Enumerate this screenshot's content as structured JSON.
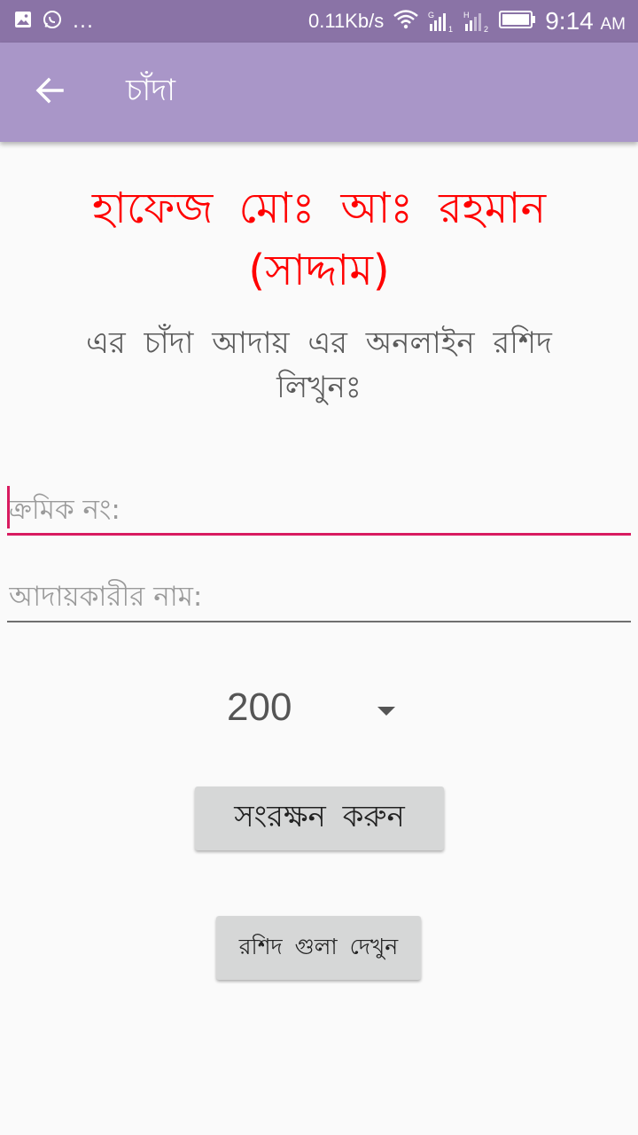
{
  "status_bar": {
    "net_speed": "0.11Kb/s",
    "time": "9:14",
    "ampm": "AM",
    "more_dots": "...",
    "icons": [
      "image-icon",
      "whatsapp-icon",
      "wifi-icon",
      "signal-g-icon",
      "signal-h-icon",
      "battery-icon"
    ],
    "signal_sim1": "1",
    "signal_sim2": "2",
    "signal_g": "G",
    "signal_h": "H"
  },
  "app_bar": {
    "title": "চাঁদা",
    "back_icon": "arrow-back-icon"
  },
  "content": {
    "heading": "হাফেজ মোঃ আঃ রহমান (সাদ্দাম)",
    "subheading": "এর চাঁদা আদায় এর অনলাইন রশিদ লিখুনঃ",
    "serial_field": {
      "placeholder": "ক্রমিক নং:",
      "value": ""
    },
    "collector_field": {
      "placeholder": "আদায়কারীর নাম:",
      "value": ""
    },
    "amount_select": {
      "selected": "200"
    },
    "save_button": "সংরক্ষন করুন",
    "view_button": "রশিদ গুলা দেখুন"
  },
  "colors": {
    "status_bar": "#8a73a6",
    "app_bar": "#a996c8",
    "heading": "#ff0000",
    "accent": "#d81b60",
    "button": "#d6d7d7"
  }
}
